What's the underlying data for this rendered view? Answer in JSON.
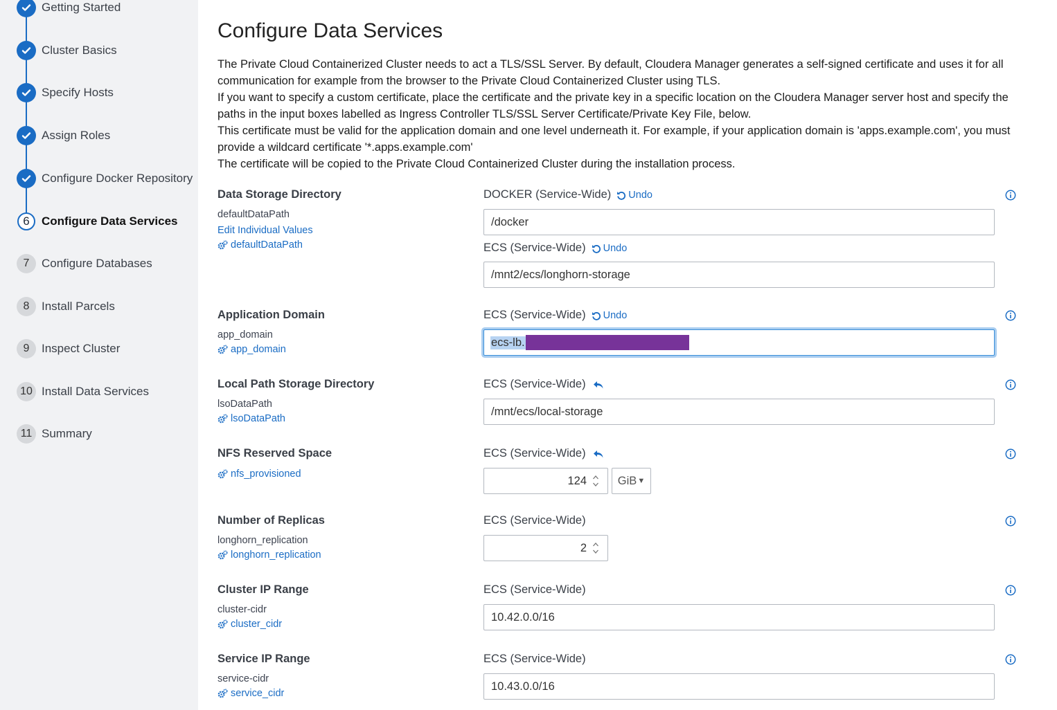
{
  "steps": [
    {
      "num": "1",
      "label": "Getting Started",
      "state": "done"
    },
    {
      "num": "2",
      "label": "Cluster Basics",
      "state": "done"
    },
    {
      "num": "3",
      "label": "Specify Hosts",
      "state": "done"
    },
    {
      "num": "4",
      "label": "Assign Roles",
      "state": "done"
    },
    {
      "num": "5",
      "label": "Configure Docker Repository",
      "state": "done"
    },
    {
      "num": "6",
      "label": "Configure Data Services",
      "state": "current"
    },
    {
      "num": "7",
      "label": "Configure Databases",
      "state": "pending"
    },
    {
      "num": "8",
      "label": "Install Parcels",
      "state": "pending"
    },
    {
      "num": "9",
      "label": "Inspect Cluster",
      "state": "pending"
    },
    {
      "num": "10",
      "label": "Install Data Services",
      "state": "pending"
    },
    {
      "num": "11",
      "label": "Summary",
      "state": "pending"
    }
  ],
  "page": {
    "title": "Configure Data Services",
    "intro": [
      "The Private Cloud Containerized Cluster needs to act a TLS/SSL Server. By default, Cloudera Manager generates a self-signed certificate and uses it for all communication for example from the browser to the Private Cloud Containerized Cluster using TLS.",
      "If you want to specify a custom certificate, place the certificate and the private key in a specific location on the Cloudera Manager server host and specify the paths in the input boxes labelled as Ingress Controller TLS/SSL Server Certificate/Private Key File, below.",
      "This certificate must be valid for the application domain and one level underneath it. For example, if your application domain is 'apps.example.com', you must provide a wildcard certificate '*.apps.example.com'",
      "The certificate will be copied to the Private Cloud Containerized Cluster during the installation process."
    ]
  },
  "common": {
    "undo": "Undo",
    "edit_individual": "Edit Individual Values"
  },
  "props": {
    "data_storage": {
      "title": "Data Storage Directory",
      "name": "defaultDataPath",
      "link": "defaultDataPath",
      "scope1": "DOCKER (Service-Wide)",
      "value1": "/docker",
      "scope2": "ECS (Service-Wide)",
      "value2": "/mnt2/ecs/longhorn-storage"
    },
    "app_domain": {
      "title": "Application Domain",
      "name": "app_domain",
      "link": "app_domain",
      "scope": "ECS (Service-Wide)",
      "value": "ecs-lb."
    },
    "local_path": {
      "title": "Local Path Storage Directory",
      "name": "lsoDataPath",
      "link": "lsoDataPath",
      "scope": "ECS (Service-Wide)",
      "value": "/mnt/ecs/local-storage"
    },
    "nfs": {
      "title": "NFS Reserved Space",
      "link": "nfs_provisioned",
      "scope": "ECS (Service-Wide)",
      "value": "124",
      "unit": "GiB"
    },
    "replicas": {
      "title": "Number of Replicas",
      "name": "longhorn_replication",
      "link": "longhorn_replication",
      "scope": "ECS (Service-Wide)",
      "value": "2"
    },
    "cluster_ip": {
      "title": "Cluster IP Range",
      "name": "cluster-cidr",
      "link": "cluster_cidr",
      "scope": "ECS (Service-Wide)",
      "value": "10.42.0.0/16"
    },
    "service_ip": {
      "title": "Service IP Range",
      "name": "service-cidr",
      "link": "service_cidr",
      "scope": "ECS (Service-Wide)",
      "value": "10.43.0.0/16"
    }
  },
  "colors": {
    "accent": "#1a6cc4",
    "sidebar_bg": "#f1f2f4",
    "redaction": "#773399"
  },
  "icons": {
    "done": "check-icon",
    "link": "gears-icon",
    "undo": "undo-icon",
    "revert": "reply-icon",
    "info": "info-icon"
  }
}
